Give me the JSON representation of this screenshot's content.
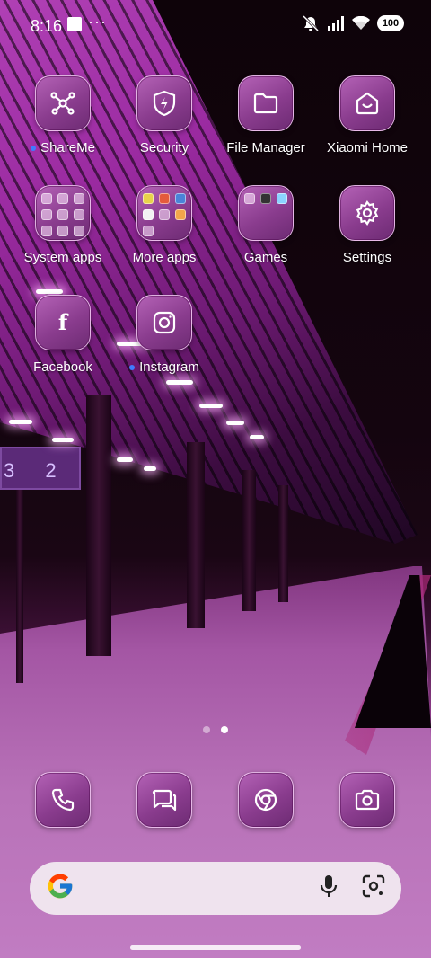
{
  "status_bar": {
    "time": "8:16",
    "overflow": "···",
    "battery": "100",
    "icons": [
      "mute-icon",
      "signal-icon",
      "wifi-icon",
      "battery-icon"
    ]
  },
  "apps": [
    {
      "label": "ShareMe",
      "icon": "share-icon",
      "new_indicator": true
    },
    {
      "label": "Security",
      "icon": "shield-icon",
      "new_indicator": false
    },
    {
      "label": "File Manager",
      "icon": "folder-icon",
      "new_indicator": false
    },
    {
      "label": "Xiaomi Home",
      "icon": "home-icon",
      "new_indicator": false
    },
    {
      "label": "System apps",
      "icon": "folder-group-icon",
      "new_indicator": false
    },
    {
      "label": "More apps",
      "icon": "folder-group-icon",
      "new_indicator": false
    },
    {
      "label": "Games",
      "icon": "folder-group-icon",
      "new_indicator": false
    },
    {
      "label": "Settings",
      "icon": "gear-icon",
      "new_indicator": false
    },
    {
      "label": "Facebook",
      "icon": "facebook-icon",
      "new_indicator": false
    },
    {
      "label": "Instagram",
      "icon": "instagram-icon",
      "new_indicator": true
    }
  ],
  "page_indicator": {
    "pages": 2,
    "current": 2
  },
  "dock": [
    {
      "name": "Phone",
      "icon": "phone-icon"
    },
    {
      "name": "Messages",
      "icon": "message-icon"
    },
    {
      "name": "Chrome",
      "icon": "chrome-icon"
    },
    {
      "name": "Camera",
      "icon": "camera-icon"
    }
  ],
  "search": {
    "value": "",
    "placeholder": ""
  },
  "wallpaper": {
    "sign_text": "3 2"
  },
  "colors": {
    "accent_dot": "#3f7bff",
    "icon_tint": "#9a4aa0",
    "search_bg": "#efe3ee"
  }
}
